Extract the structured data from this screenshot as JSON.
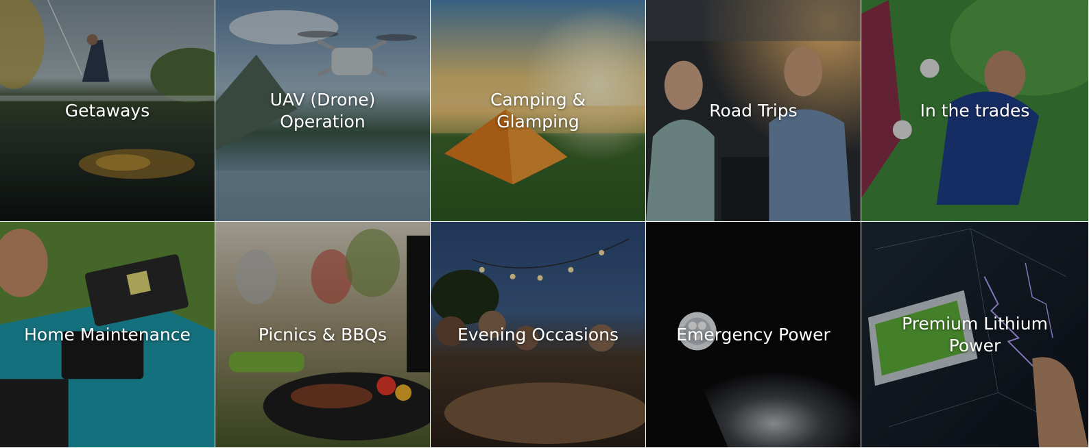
{
  "tiles": [
    {
      "lines": [
        "Getaways"
      ]
    },
    {
      "lines": [
        "UAV (Drone)",
        "Operation"
      ]
    },
    {
      "lines": [
        "Camping &",
        "Glamping"
      ]
    },
    {
      "lines": [
        "Road Trips"
      ]
    },
    {
      "lines": [
        "In the trades"
      ]
    },
    {
      "lines": [
        "Home Maintenance"
      ]
    },
    {
      "lines": [
        "Picnics & BBQs"
      ]
    },
    {
      "lines": [
        "Evening Occasions"
      ]
    },
    {
      "lines": [
        "Emergency Power"
      ]
    },
    {
      "lines": [
        "Premium Lithium",
        "Power"
      ]
    }
  ]
}
